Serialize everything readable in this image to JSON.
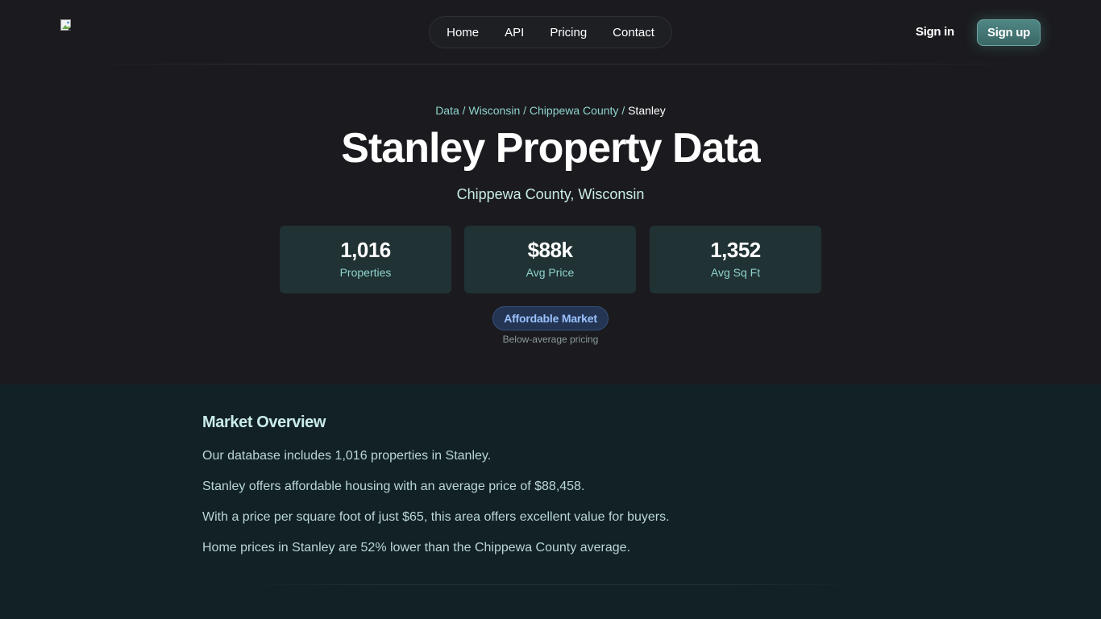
{
  "header": {
    "logo_icon": "broken-image-icon",
    "nav": [
      {
        "label": "Home"
      },
      {
        "label": "API"
      },
      {
        "label": "Pricing"
      },
      {
        "label": "Contact"
      }
    ],
    "signin_label": "Sign in",
    "signup_label": "Sign up"
  },
  "breadcrumb": {
    "items": [
      "Data",
      "Wisconsin",
      "Chippewa County"
    ],
    "separator": "/",
    "current": "Stanley"
  },
  "hero": {
    "title": "Stanley Property Data",
    "subtitle": "Chippewa County, Wisconsin"
  },
  "stats": [
    {
      "value": "1,016",
      "label": "Properties"
    },
    {
      "value": "$88k",
      "label": "Avg Price"
    },
    {
      "value": "1,352",
      "label": "Avg Sq Ft"
    }
  ],
  "badge": {
    "label": "Affordable Market",
    "note": "Below-average pricing"
  },
  "overview": {
    "heading": "Market Overview",
    "paragraphs": [
      "Our database includes 1,016 properties in Stanley.",
      "Stanley offers affordable housing with an average price of $88,458.",
      "With a price per square foot of just $65, this area offers excellent value for buyers.",
      "Home prices in Stanley are 52% lower than the Chippewa County average."
    ]
  },
  "colors": {
    "background": "#1b1b1f",
    "accent": "#8fd3cc",
    "card": "#203234",
    "section": "#122125",
    "badge": "#233553",
    "badge_text": "#9bc2ff",
    "signup": "#4f8684"
  }
}
